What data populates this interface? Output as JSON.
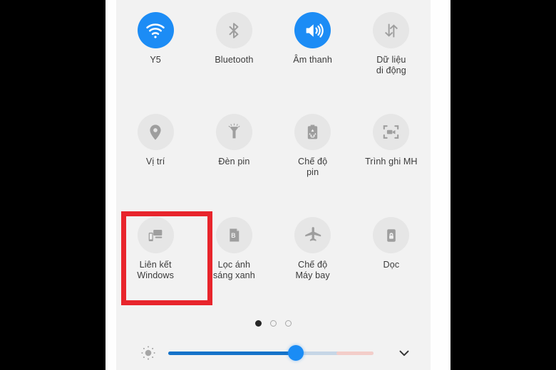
{
  "panel": {
    "background_color": "#f2f2f2",
    "accent_color": "#1c8cf5",
    "highlight_color": "#e8252c"
  },
  "tiles": [
    [
      {
        "label": "Y5",
        "icon": "wifi-icon",
        "active": true
      },
      {
        "label": "Bluetooth",
        "icon": "bluetooth-icon",
        "active": false
      },
      {
        "label": "Âm thanh",
        "icon": "volume-icon",
        "active": true
      },
      {
        "label": "Dữ liệu\ndi động",
        "icon": "mobile-data-icon",
        "active": false
      }
    ],
    [
      {
        "label": "Vị trí",
        "icon": "location-pin-icon",
        "active": false
      },
      {
        "label": "Đèn pin",
        "icon": "flashlight-icon",
        "active": false
      },
      {
        "label": "Chế độ\npin",
        "icon": "battery-saver-icon",
        "active": false
      },
      {
        "label": "Trình ghi MH",
        "icon": "screen-recorder-icon",
        "active": false
      }
    ],
    [
      {
        "label": "Liên kết\nWindows",
        "icon": "link-to-windows-icon",
        "active": false,
        "highlighted": true
      },
      {
        "label": "Lọc ánh\nsáng xanh",
        "icon": "blue-light-filter-icon",
        "active": false
      },
      {
        "label": "Chế độ\nMáy bay",
        "icon": "airplane-mode-icon",
        "active": false
      },
      {
        "label": "Dọc",
        "icon": "rotation-lock-icon",
        "active": false
      }
    ]
  ],
  "pagination": {
    "total_pages": 3,
    "current_page": 1
  },
  "brightness": {
    "icon": "brightness-sun-icon",
    "value_percent": 62,
    "expand_icon": "chevron-down-icon"
  }
}
